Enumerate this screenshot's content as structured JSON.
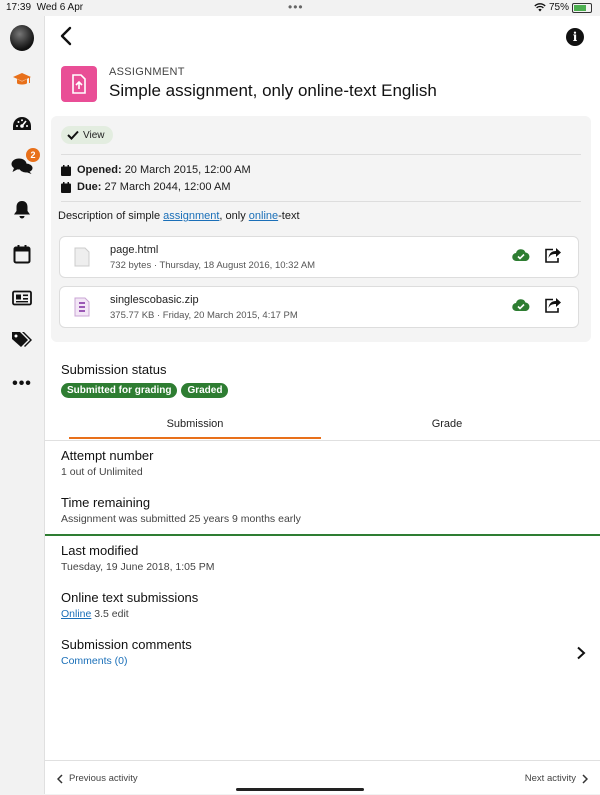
{
  "status_bar": {
    "time": "17:39",
    "date": "Wed 6 Apr",
    "battery": "75%",
    "battery_level": 0.75
  },
  "sidebar": {
    "messages_badge": "2",
    "items": [
      "avatar",
      "graduation-cap-icon",
      "dashboard-icon",
      "messages-icon",
      "bell-icon",
      "calendar-icon",
      "grades-card-icon",
      "tags-icon",
      "more-icon"
    ]
  },
  "header": {
    "type_label": "ASSIGNMENT",
    "title": "Simple assignment, only online-text English"
  },
  "activity": {
    "view_label": "View",
    "opened_label": "Opened:",
    "opened_value": "20 March 2015, 12:00 AM",
    "due_label": "Due:",
    "due_value": "27 March 2044, 12:00 AM",
    "desc_pre": "Description of simple ",
    "desc_link1": "assignment",
    "desc_mid": ", only ",
    "desc_link2": "online",
    "desc_post": "-text",
    "files": [
      {
        "name": "page.html",
        "meta": "732 bytes · Thursday, 18 August 2016, 10:32 AM"
      },
      {
        "name": "singlescobasic.zip",
        "meta": "375.77 KB · Friday, 20 March 2015, 4:17 PM"
      }
    ]
  },
  "submission": {
    "status_title": "Submission status",
    "badges": [
      "Submitted for grading",
      "Graded"
    ],
    "tabs": [
      "Submission",
      "Grade"
    ],
    "attempt_title": "Attempt number",
    "attempt_value": "1 out of Unlimited",
    "time_title": "Time remaining",
    "time_value": "Assignment was submitted 25 years 9 months early",
    "modified_title": "Last modified",
    "modified_value": "Tuesday, 19 June 2018, 1:05 PM",
    "online_title": "Online text submissions",
    "online_link": "Online",
    "online_rest": " 3.5 edit",
    "comments_title": "Submission comments",
    "comments_link": "Comments (0)"
  },
  "footer": {
    "prev": "Previous activity",
    "next": "Next activity"
  },
  "colors": {
    "accent": "#e8701a",
    "success": "#2e7d32",
    "module": "#e94e96",
    "link": "#1a6fb8"
  }
}
